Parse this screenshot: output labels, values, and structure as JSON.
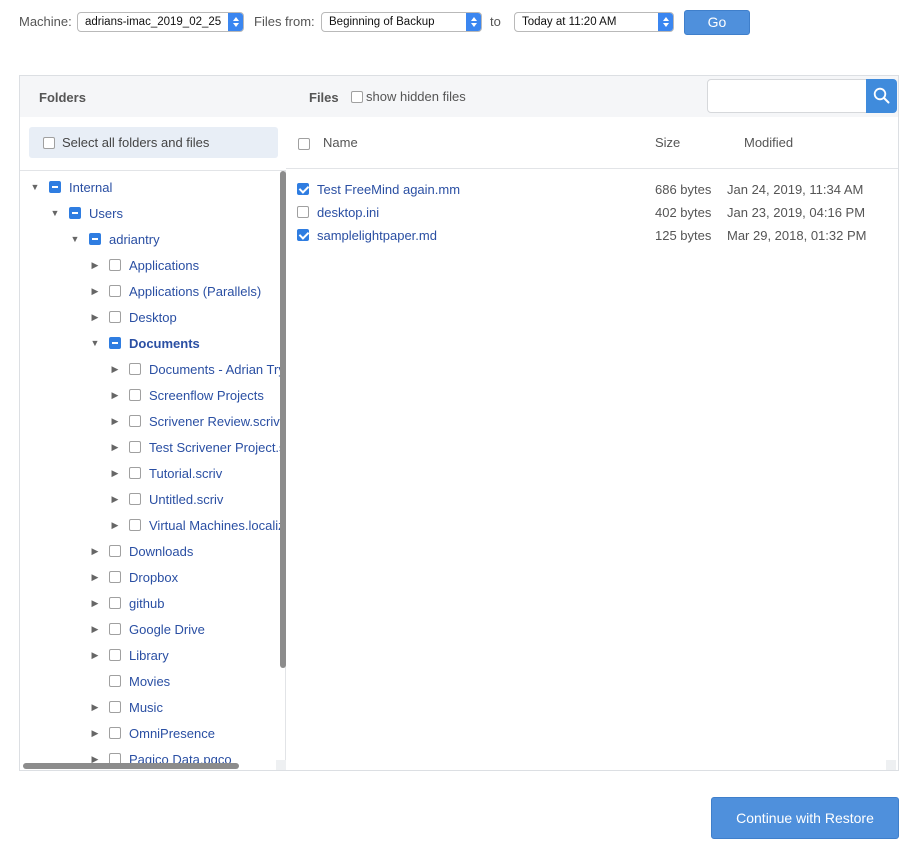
{
  "toolbar": {
    "machine_label": "Machine:",
    "machine_value": "adrians-imac_2019_02_25",
    "files_from_label": "Files from:",
    "files_from_value": "Beginning of Backup",
    "to_label": "to",
    "to_value": "Today at 11:20 AM",
    "go_label": "Go"
  },
  "panel": {
    "folders_heading": "Folders",
    "files_heading": "Files",
    "show_hidden_label": "show hidden files",
    "search_placeholder": "",
    "select_all_label": "Select all folders and files"
  },
  "tree": [
    {
      "label": "Internal",
      "depth": 0,
      "state": "partial",
      "expander": "open"
    },
    {
      "label": "Users",
      "depth": 1,
      "state": "partial",
      "expander": "open"
    },
    {
      "label": "adriantry",
      "depth": 2,
      "state": "partial",
      "expander": "open"
    },
    {
      "label": "Applications",
      "depth": 3,
      "state": "unchecked",
      "expander": "closed"
    },
    {
      "label": "Applications (Parallels)",
      "depth": 3,
      "state": "unchecked",
      "expander": "closed"
    },
    {
      "label": "Desktop",
      "depth": 3,
      "state": "unchecked",
      "expander": "closed"
    },
    {
      "label": "Documents",
      "depth": 3,
      "state": "partial",
      "expander": "open",
      "bold": true
    },
    {
      "label": "Documents - Adrian Try's MacBook Pro",
      "depth": 4,
      "state": "unchecked",
      "expander": "closed"
    },
    {
      "label": "Screenflow Projects",
      "depth": 4,
      "state": "unchecked",
      "expander": "closed"
    },
    {
      "label": "Scrivener Review.scriv",
      "depth": 4,
      "state": "unchecked",
      "expander": "closed"
    },
    {
      "label": "Test Scrivener Project.scriv",
      "depth": 4,
      "state": "unchecked",
      "expander": "closed"
    },
    {
      "label": "Tutorial.scriv",
      "depth": 4,
      "state": "unchecked",
      "expander": "closed"
    },
    {
      "label": "Untitled.scriv",
      "depth": 4,
      "state": "unchecked",
      "expander": "closed"
    },
    {
      "label": "Virtual Machines.localized",
      "depth": 4,
      "state": "unchecked",
      "expander": "closed"
    },
    {
      "label": "Downloads",
      "depth": 3,
      "state": "unchecked",
      "expander": "closed"
    },
    {
      "label": "Dropbox",
      "depth": 3,
      "state": "unchecked",
      "expander": "closed"
    },
    {
      "label": "github",
      "depth": 3,
      "state": "unchecked",
      "expander": "closed"
    },
    {
      "label": "Google Drive",
      "depth": 3,
      "state": "unchecked",
      "expander": "closed"
    },
    {
      "label": "Library",
      "depth": 3,
      "state": "unchecked",
      "expander": "closed"
    },
    {
      "label": "Movies",
      "depth": 3,
      "state": "unchecked",
      "expander": "none"
    },
    {
      "label": "Music",
      "depth": 3,
      "state": "unchecked",
      "expander": "closed"
    },
    {
      "label": "OmniPresence",
      "depth": 3,
      "state": "unchecked",
      "expander": "closed"
    },
    {
      "label": "Pagico Data.pgco",
      "depth": 3,
      "state": "unchecked",
      "expander": "closed"
    }
  ],
  "files_table": {
    "headers": {
      "name": "Name",
      "size": "Size",
      "modified": "Modified"
    },
    "rows": [
      {
        "name": "Test FreeMind again.mm",
        "size": "686 bytes",
        "modified": "Jan 24, 2019, 11:34 AM",
        "checked": true
      },
      {
        "name": "desktop.ini",
        "size": "402 bytes",
        "modified": "Jan 23, 2019, 04:16 PM",
        "checked": false
      },
      {
        "name": "samplelightpaper.md",
        "size": "125 bytes",
        "modified": "Mar 29, 2018, 01:32 PM",
        "checked": true
      }
    ]
  },
  "footer": {
    "restore_label": "Continue with Restore"
  },
  "colors": {
    "accent": "#4f90dc",
    "link": "#2a4fa3",
    "checkbox_on": "#2f7de1"
  }
}
